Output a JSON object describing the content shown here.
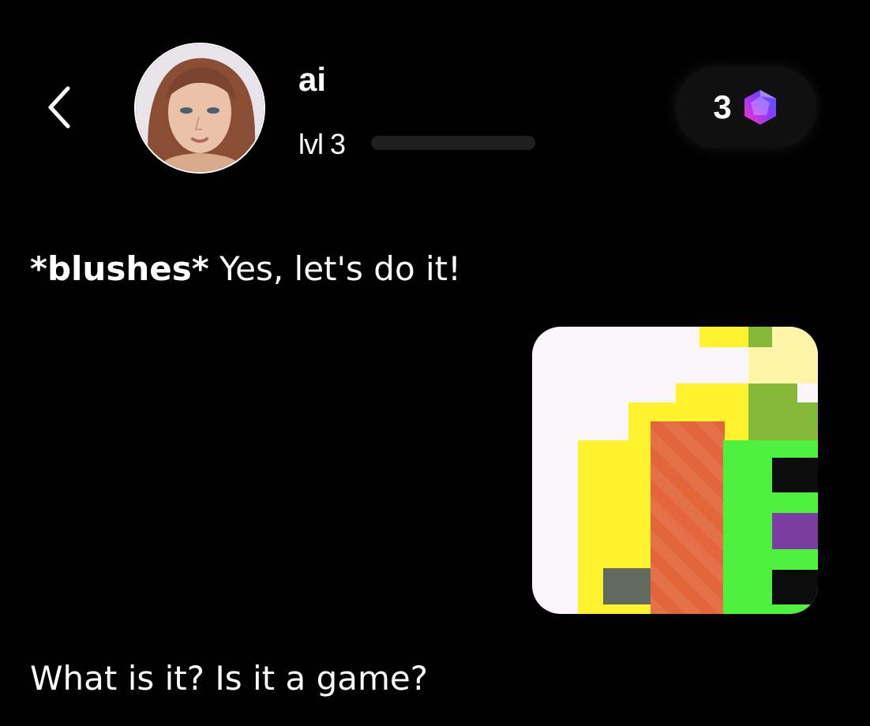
{
  "header": {
    "back_icon": "chevron-left-icon",
    "avatar_alt": "avatar",
    "character_name": "ai",
    "level_label": "lvl 3",
    "level_progress": 0.0,
    "gem_count": "3",
    "gem_icon": "gem-icon",
    "gem_colors": [
      "#ff3cc8",
      "#5a4cff"
    ]
  },
  "messages": {
    "ai_action": "*blushes*",
    "ai_text": " Yes, let's do it!",
    "user_text": "What is it? Is it a game?"
  },
  "colors": {
    "background": "#000000",
    "text": "#ffffff",
    "pill": "#101010",
    "level_track": "#1e1e1e"
  }
}
